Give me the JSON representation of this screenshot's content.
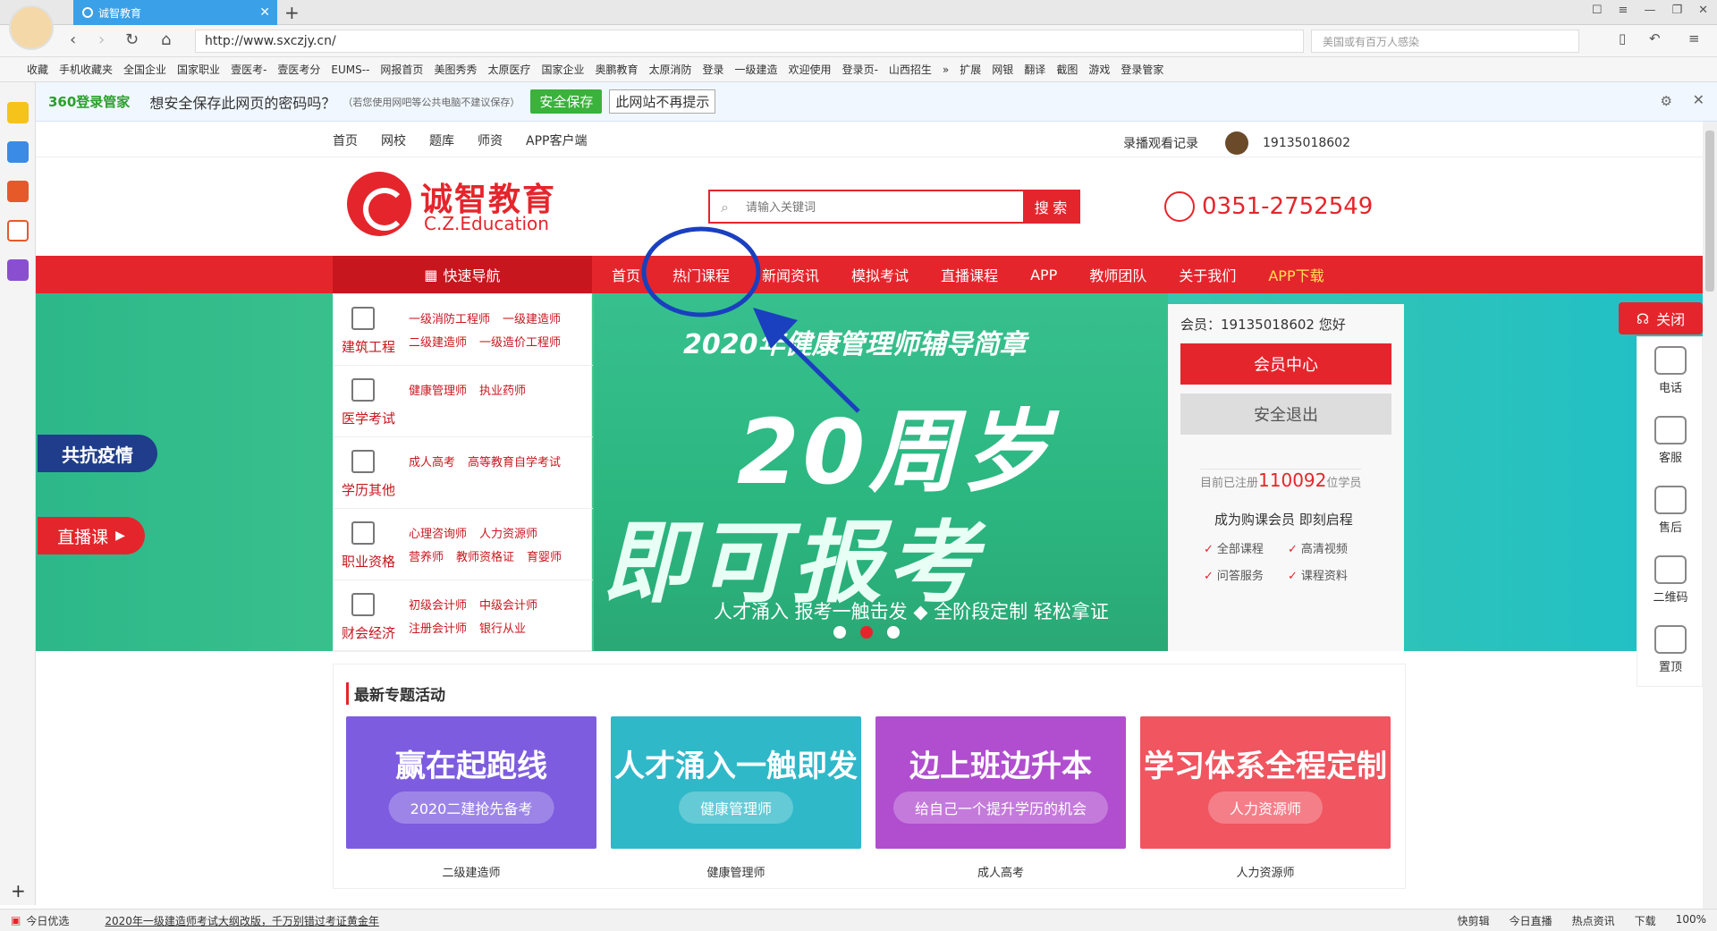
{
  "browser": {
    "tab_title": "诚智教育",
    "url": "http://www.sxczjy.cn/",
    "search_placeholder": "美国或有百万人感染",
    "bookmarks": [
      "收藏",
      "手机收藏夹",
      "全国企业",
      "国家职业",
      "壹医考-",
      "壹医考分",
      "EUMS--",
      "网报首页",
      "美图秀秀",
      "太原医疗",
      "国家企业",
      "奥鹏教育",
      "太原消防",
      "登录",
      "一级建造",
      "欢迎使用",
      "登录页-",
      "山西招生",
      "»",
      "扩展",
      "网银",
      "翻译",
      "截图",
      "游戏",
      "登录管家"
    ],
    "pw_brand": "360登录管家",
    "pw_question": "想安全保存此网页的密码吗？",
    "pw_hint": "（若您使用网吧等公共电脑不建议保存）",
    "pw_save": "安全保存",
    "pw_never": "此网站不再提示",
    "status_left": "今日优选",
    "status_news": "2020年一级建造师考试大纲改版，千万别错过考证黄金年",
    "status_right": [
      "快剪辑",
      "今日直播",
      "热点资讯",
      "下载",
      "100%"
    ]
  },
  "site": {
    "topnav": [
      "首页",
      "网校",
      "题库",
      "师资",
      "APP客户端"
    ],
    "history": "录播观看记录",
    "user": "19135018602",
    "logo_cn": "诚智教育",
    "logo_en": "C.Z.Education",
    "search_placeholder": "请输入关键词",
    "search_btn": "搜 索",
    "phone": "0351-2752549",
    "quicknav": "快速导航",
    "menu": [
      "首页",
      "热门课程",
      "新闻资讯",
      "模拟考试",
      "直播课程",
      "APP",
      "教师团队",
      "关于我们"
    ],
    "menu_app": "APP下载",
    "categories": [
      {
        "name": "建筑工程",
        "links": [
          "一级消防工程师",
          "一级建造师",
          "二级建造师",
          "一级造价工程师"
        ]
      },
      {
        "name": "医学考试",
        "links": [
          "健康管理师",
          "执业药师"
        ]
      },
      {
        "name": "学历其他",
        "links": [
          "成人高考",
          "高等教育自学考试"
        ]
      },
      {
        "name": "职业资格",
        "links": [
          "心理咨询师",
          "人力资源师",
          "营养师",
          "教师资格证",
          "育婴师"
        ]
      },
      {
        "name": "财会经济",
        "links": [
          "初级会计师",
          "中级会计师",
          "注册会计师",
          "银行从业"
        ]
      }
    ],
    "slide_title": "2020年健康管理师辅导简章",
    "slide_big1": "20周岁",
    "slide_big2": "即可报考",
    "slide_sub": "人才涌入 报考一触击发 ◆ 全阶段定制 轻松拿证",
    "member_hello": "会员：19135018602 您好",
    "member_center": "会员中心",
    "member_logout": "安全退出",
    "reg_prefix": "目前已注册",
    "reg_count": "110092",
    "reg_suffix": "位学员",
    "buy_text": "成为购课会员 即刻启程",
    "features": [
      "全部课程",
      "高清视频",
      "问答服务",
      "课程资料"
    ],
    "kangyi": "共抗疫情",
    "live": "直播课",
    "right_close": "关闭",
    "right_items": [
      "电话",
      "客服",
      "售后",
      "二维码",
      "置顶"
    ],
    "special_title": "最新专题活动",
    "cards": [
      {
        "title": "赢在起跑线",
        "pill": "2020二建抢先备考",
        "caption": "二级建造师",
        "color": "#7d5ce0"
      },
      {
        "title": "人才涌入一触即发",
        "pill": "健康管理师",
        "caption": "健康管理师",
        "color": "#2fb8c8"
      },
      {
        "title": "边上班边升本",
        "pill": "给自己一个提升学历的机会",
        "caption": "成人高考",
        "color": "#b04ecf"
      },
      {
        "title": "学习体系全程定制",
        "pill": "人力资源师",
        "caption": "人力资源师",
        "color": "#f05560"
      }
    ]
  }
}
